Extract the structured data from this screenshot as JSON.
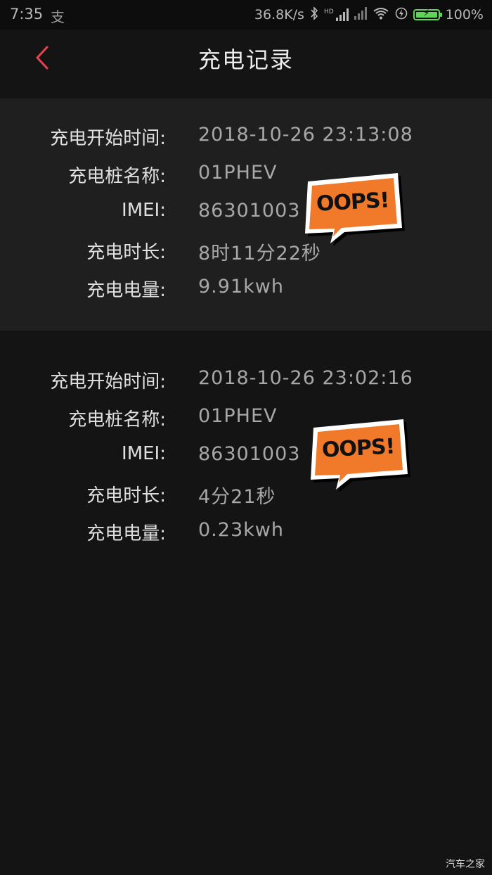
{
  "status_bar": {
    "time": "7:35",
    "alipay_glyph": "支",
    "net_speed": "36.8K/s",
    "hd_label": "HD",
    "battery_percent": "100%",
    "battery_level": 1.0
  },
  "header": {
    "title": "充电记录",
    "back_icon": "chevron-left-icon",
    "accent_color": "#e8424f"
  },
  "records": [
    {
      "start_time_label": "充电开始时间:",
      "start_time": "2018-10-26 23:13:08",
      "pile_name_label": "充电桩名称:",
      "pile_name": "01PHEV",
      "imei_label": "IMEI:",
      "imei": "86301003",
      "duration_label": "充电时长:",
      "duration": "8时11分22秒",
      "energy_label": "充电电量:",
      "energy": "9.91kwh",
      "sticker": "OOPS!"
    },
    {
      "start_time_label": "充电开始时间:",
      "start_time": "2018-10-26 23:02:16",
      "pile_name_label": "充电桩名称:",
      "pile_name": "01PHEV",
      "imei_label": "IMEI:",
      "imei": "86301003",
      "duration_label": "充电时长:",
      "duration": "4分21秒",
      "energy_label": "充电电量:",
      "energy": "0.23kwh",
      "sticker": "OOPS!"
    }
  ],
  "watermark": "汽车之家",
  "colors": {
    "background": "#141414",
    "record_alt_bg": "#1f1f1f",
    "sticker_orange": "#f07a2a"
  }
}
